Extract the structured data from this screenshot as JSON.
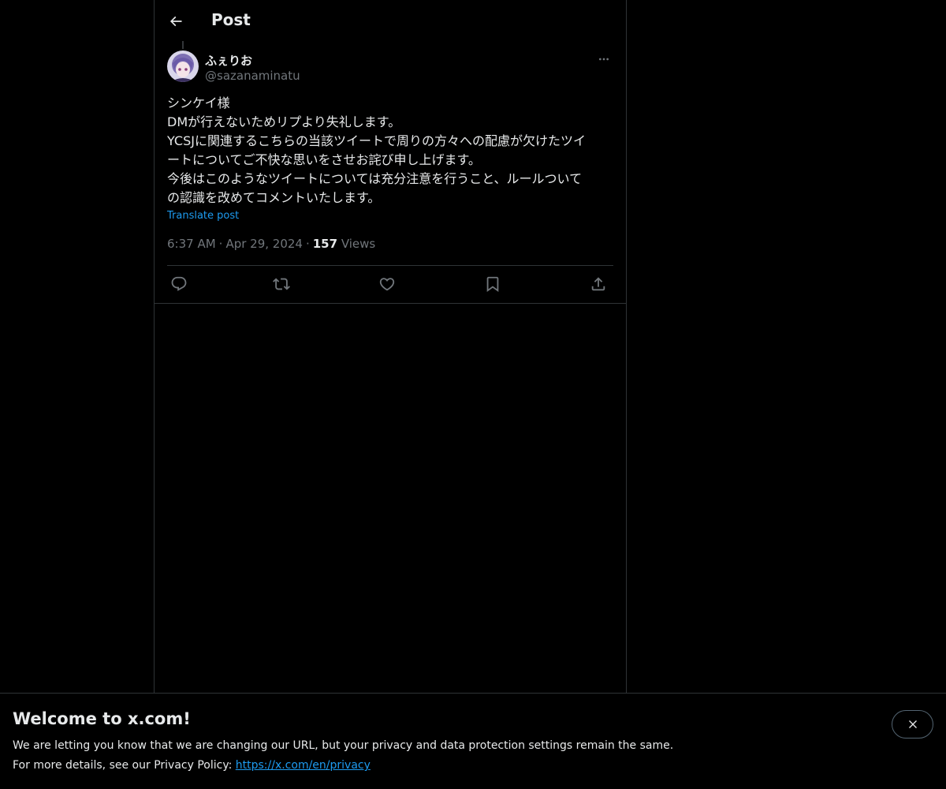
{
  "header": {
    "title": "Post",
    "back_icon": "arrow-left-icon"
  },
  "post": {
    "author": {
      "display_name": "ふぇりお",
      "handle": "@sazanaminatu",
      "avatar_icon": "avatar-anime-girl"
    },
    "more_icon": "ellipsis-icon",
    "text_lines": [
      "シンケイ様",
      "DMが行えないためリプより失礼します。",
      "YCSJに関連するこちらの当該ツイートで周りの方々への配慮が欠けたツイ",
      "ートについてご不快な思いをさせお詫び申し上げます。",
      "今後はこのようなツイートについては充分注意を行うこと、ルールついて",
      "の認識を改めてコメントいたします。"
    ],
    "translate_label": "Translate post",
    "time": "6:37 AM",
    "separator": "·",
    "date": "Apr 29, 2024",
    "views_count": "157",
    "views_label": "Views",
    "actions": [
      {
        "name": "reply",
        "icon": "reply-icon"
      },
      {
        "name": "repost",
        "icon": "repost-icon"
      },
      {
        "name": "like",
        "icon": "heart-icon"
      },
      {
        "name": "bookmark",
        "icon": "bookmark-icon"
      },
      {
        "name": "share",
        "icon": "share-icon"
      }
    ]
  },
  "banner": {
    "title": "Welcome to x.com!",
    "line1": "We are letting you know that we are changing our URL, but your privacy and data protection settings remain the same.",
    "line2_prefix": "For more details, see our Privacy Policy: ",
    "link_text": "https://x.com/en/privacy",
    "close_icon": "close-icon"
  },
  "colors": {
    "background": "#000000",
    "text": "#e7e9ea",
    "muted": "#71767b",
    "accent": "#1d9bf0",
    "border": "#2f3336"
  }
}
